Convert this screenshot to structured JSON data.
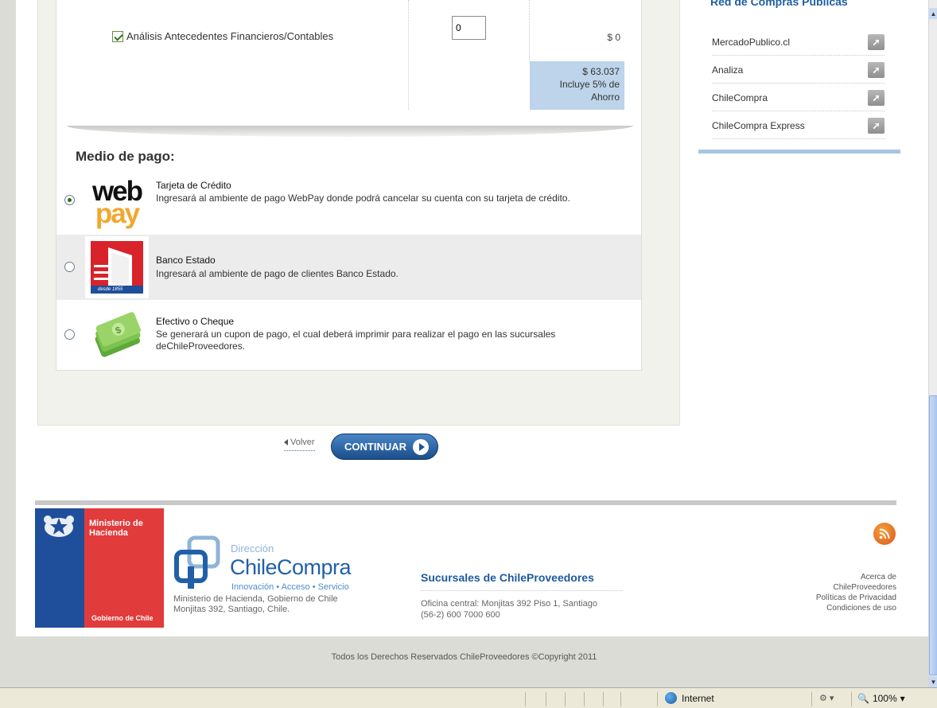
{
  "product": {
    "label": "Análisis Antecedentes Financieros/Contables",
    "quantity": "0",
    "price": "$ 0",
    "total_amount": "$ 63.037",
    "total_note_1": "Incluye 5% de",
    "total_note_2": "Ahorro"
  },
  "payment": {
    "title": "Medio de pago:",
    "options": [
      {
        "title": "Tarjeta de Crédito",
        "desc": "Ingresará al ambiente de pago WebPay donde podrá cancelar su cuenta con su tarjeta de crédito.",
        "logo": "webpay-logo",
        "selected": true
      },
      {
        "title": "Banco Estado",
        "desc": "Ingresará al ambiente de pago de clientes Banco Estado.",
        "logo": "banco-estado-logo",
        "selected": false
      },
      {
        "title": "Efectivo o Cheque",
        "desc": "Se generará un cupon de pago, el cual deberá imprimir para realizar el pago en las sucursales deChileProveedores.",
        "logo": "cash-logo",
        "selected": false
      }
    ],
    "webpay_text_1": "web",
    "webpay_text_2": "pay",
    "banco_text": "desde 1855"
  },
  "nav": {
    "back_label": "Volver",
    "continue_label": "CONTINUAR"
  },
  "sidebar": {
    "heading": "Red de Compras Públicas",
    "items": [
      {
        "label": "MercadoPublico.cl"
      },
      {
        "label": "Analiza"
      },
      {
        "label": "ChileCompra"
      },
      {
        "label": "ChileCompra Express"
      }
    ],
    "item_icon": "external-link-icon"
  },
  "footer": {
    "ministerio_1": "Ministerio de",
    "ministerio_2": "Hacienda",
    "gobierno": "Gobierno de Chile",
    "cc_direccion": "Dirección",
    "cc_name": "ChileCompra",
    "cc_tagline": "Innovación • Acceso • Servicio",
    "cc_address_1": "Ministerio de Hacienda, Gobierno de Chile",
    "cc_address_2": "Monjitas 392, Santiago, Chile.",
    "sucursales_title": "Sucursales de ChileProveedores",
    "sucursales_address_1": "Oficina central: Monjitas 392 Piso 1, Santiago",
    "sucursales_address_2": "(56-2) 600 7000 600",
    "links": [
      "Acerca de",
      "ChileProveedores",
      "Políticas de Privacidad",
      "Condiciones de uso"
    ],
    "copyright": "Todos los Derechos Reservados ChileProveedores ©Copyright 2011"
  },
  "statusbar": {
    "zone": "Internet",
    "zoom": "100%"
  },
  "colors": {
    "accent_blue": "#1d5a9e",
    "total_bg": "#bdd4ea",
    "button_blue": "#1b4d8a",
    "ministerio_red": "#e23b3b",
    "ministerio_blue": "#1f4f9a",
    "rss_orange": "#e8761e"
  }
}
